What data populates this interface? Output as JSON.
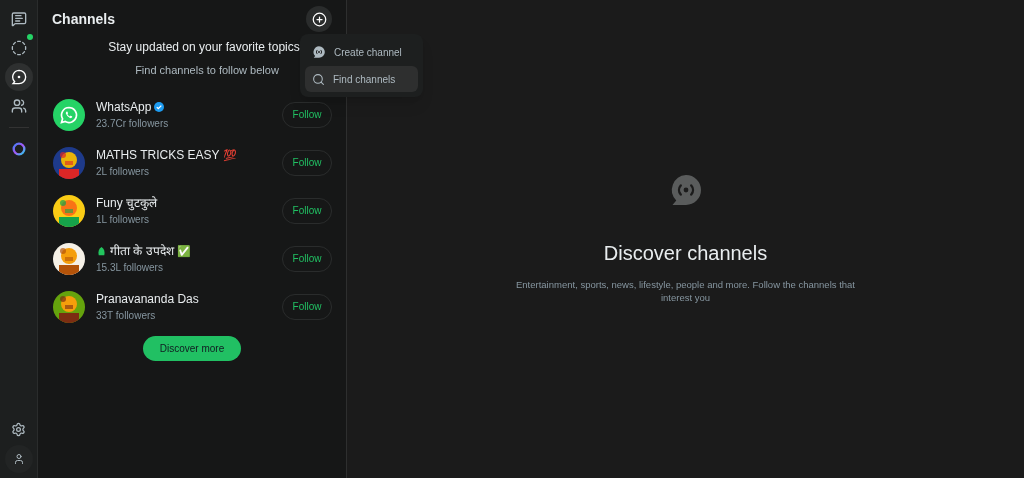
{
  "rail": {
    "top": [
      {
        "kind": "chats",
        "selected": false,
        "dot": false
      },
      {
        "kind": "status",
        "selected": false,
        "dot": true
      },
      {
        "kind": "channels",
        "selected": true,
        "dot": false
      },
      {
        "kind": "communities",
        "selected": false,
        "dot": false
      },
      {
        "kind": "ai",
        "selected": false,
        "dot": false
      }
    ],
    "bottom": [
      {
        "kind": "settings",
        "selected": false,
        "dot": false
      },
      {
        "kind": "profile",
        "selected": false,
        "dot": false
      }
    ]
  },
  "panel": {
    "title": "Channels",
    "heading": "Stay updated on your favorite topics",
    "subheading": "Find channels to follow below",
    "menu": [
      {
        "kind": "create",
        "label": "Create channel",
        "selected": false
      },
      {
        "kind": "find",
        "label": "Find channels",
        "selected": true
      }
    ],
    "channels": [
      {
        "name": "WhatsApp",
        "lead": false,
        "verified": true,
        "followers": "23.7Cr followers",
        "follow": "Follow",
        "kind": "logo"
      },
      {
        "name": "MATHS TRICKS EASY",
        "suffix": "💯",
        "lead": false,
        "verified": false,
        "followers": "2L followers",
        "follow": "Follow",
        "kind": "picture"
      },
      {
        "name": "Funy चुटकुले",
        "lead": false,
        "verified": false,
        "followers": "1L followers",
        "follow": "Follow",
        "kind": "picture"
      },
      {
        "name": "गीता के उपदेश",
        "suffix": "✅",
        "lead": true,
        "verified": false,
        "followers": "15.3L followers",
        "follow": "Follow",
        "kind": "picture"
      },
      {
        "name": "Pranavananda Das",
        "lead": false,
        "verified": false,
        "followers": "33T followers",
        "follow": "Follow",
        "kind": "picture"
      }
    ],
    "discover_button": "Discover more"
  },
  "main": {
    "title": "Discover channels",
    "text": "Entertainment, sports, news, lifestyle, people and more. Follow the channels that interest you"
  }
}
